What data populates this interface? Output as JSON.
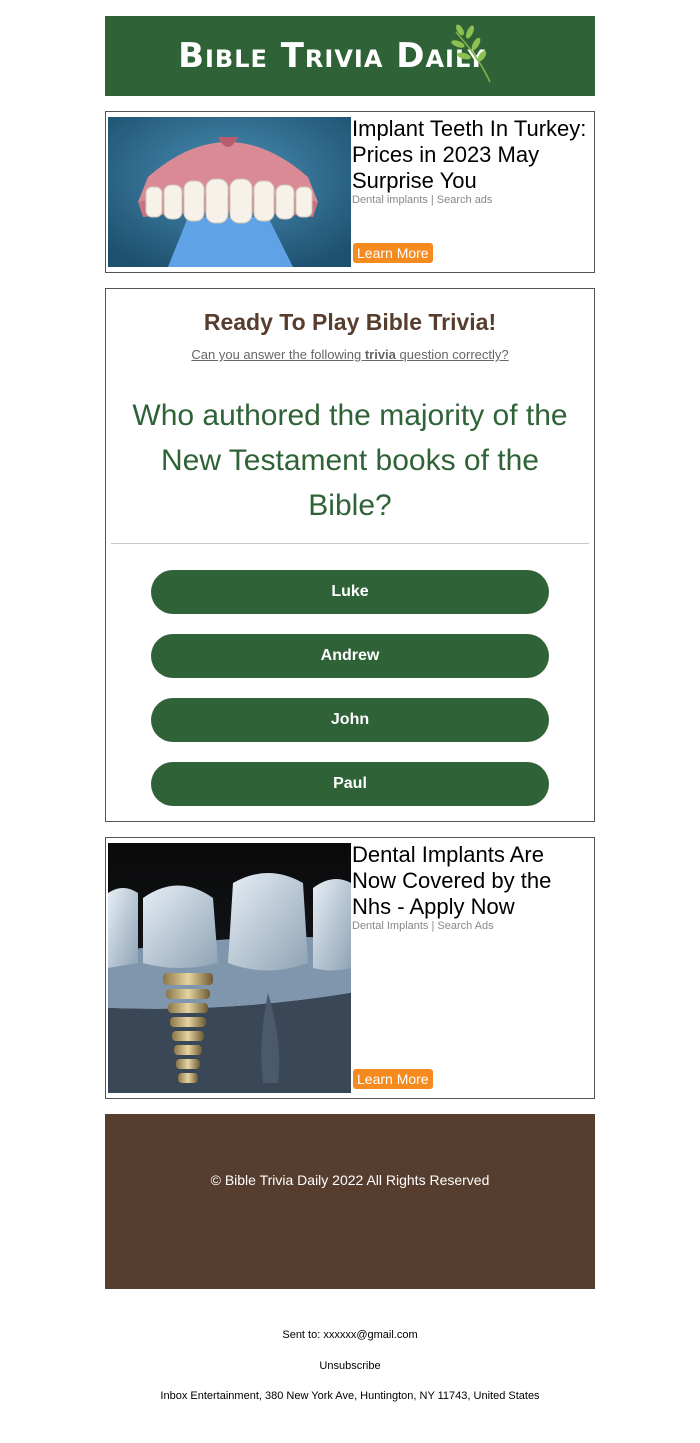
{
  "header": {
    "title": "Bible Trivia Daily",
    "leaf_icon": "olive-branch-icon",
    "bg_color": "#2f6337"
  },
  "ads": [
    {
      "title": "Implant Teeth In Turkey: Prices in 2023 May Surprise You",
      "source": "Dental implants | Search ads",
      "cta": "Learn More"
    },
    {
      "title": "Dental Implants Are Now Covered by the Nhs - Apply Now",
      "source": "Dental Implants | Search Ads",
      "cta": "Learn More"
    }
  ],
  "trivia": {
    "heading": "Ready To Play Bible Trivia!",
    "sub_before": "Can you answer the following ",
    "sub_bold": "trivia",
    "sub_after": " question correctly?",
    "question": "Who authored the majority of the New Testament books of the Bible?",
    "answers": [
      "Luke",
      "Andrew",
      "John",
      "Paul"
    ],
    "accent_color": "#2f6337",
    "heading_color": "#573d2e"
  },
  "footer": {
    "copyright": "© Bible Trivia Daily 2022 All Rights Reserved",
    "sent_to": "Sent to: xxxxxx@gmail.com",
    "unsubscribe": "Unsubscribe",
    "address": "Inbox Entertainment, 380 New York Ave, Huntington, NY 11743, United States",
    "bg_color": "#573d2e"
  },
  "cta_color": "#f58a1f"
}
